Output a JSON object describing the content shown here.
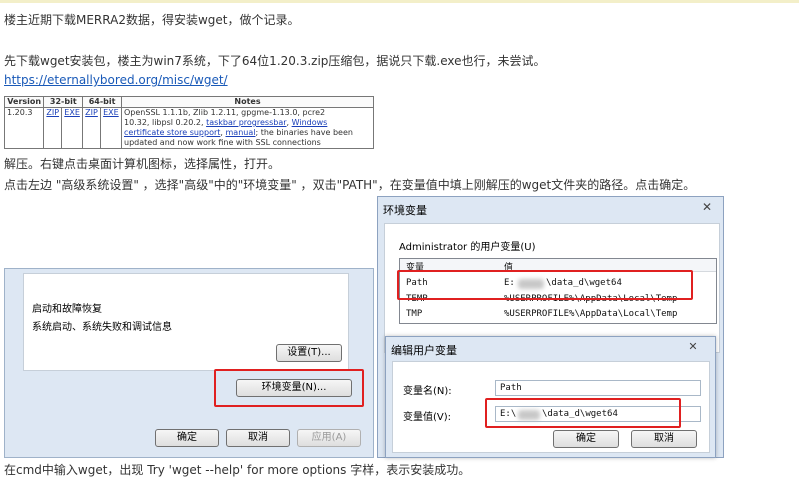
{
  "post": {
    "line1": "楼主近期下载MERRA2数据，得安装wget，做个记录。",
    "line2": "先下载wget安装包，楼主为win7系统，下了64位1.20.3.zip压缩包，据说只下载.exe也行，未尝试。",
    "link": "https://eternallybored.org/misc/wget/",
    "line3": "解压。右键点击桌面计算机图标，选择属性，打开。",
    "line4": "点击左边 \"高级系统设置\"  ，选择\"高级\"中的\"环境变量\"  ，双击\"PATH\"，在变量值中填上刚解压的wget文件夹的路径。点击确定。",
    "line5": "在cmd中输入wget，出现 Try 'wget --help' for more options 字样，表示安装成功。"
  },
  "wget_table": {
    "headers": [
      "Version",
      "32-bit",
      "64-bit",
      "Notes"
    ],
    "row": {
      "version": "1.20.3",
      "zip32": "ZIP",
      "exe32": "EXE",
      "zip64": "ZIP",
      "exe64": "EXE",
      "notes_a": "OpenSSL 1.1.1b, Zlib 1.2.11, gpgme-1.13.0, pcre2",
      "notes_b": "10.32, libpsl 0.20.2, ",
      "notes_link1": "taskbar progressbar",
      "notes_c": ", ",
      "notes_link2": "Windows",
      "notes_link2b": "certificate store support",
      "notes_d": ", ",
      "notes_link3": "manual",
      "notes_e": "; the binaries have been",
      "notes_f": "updated and now work fine with SSL connections"
    }
  },
  "system_props": {
    "section_title": "启动和故障恢复",
    "section_desc": "系统启动、系统失败和调试信息",
    "settings_button": "设置(T)...",
    "env_button": "环境变量(N)...",
    "ok_button": "确定",
    "cancel_button": "取消",
    "apply_button": "应用(A)"
  },
  "env_dialog": {
    "title": "环境变量",
    "user_vars_label": "Administrator 的用户变量(U)",
    "col_var": "变量",
    "col_val": "值",
    "rows": [
      {
        "name": "Path",
        "value_prefix": "E:",
        "value_suffix": "\\data_d\\wget64"
      },
      {
        "name": "TEMP",
        "value": "%USERPROFILE%\\AppData\\Local\\Temp"
      },
      {
        "name": "TMP",
        "value": "%USERPROFILE%\\AppData\\Local\\Temp"
      }
    ]
  },
  "edit_dialog": {
    "title": "编辑用户变量",
    "name_label": "变量名(N):",
    "name_value": "Path",
    "value_label": "变量值(V):",
    "value_prefix": "E:\\",
    "value_suffix": "\\data_d\\wget64",
    "ok_button": "确定",
    "cancel_button": "取消"
  },
  "colors": {
    "highlight": "#e02020",
    "link": "#1a5ab8",
    "dialog_frame": "#dde7f3"
  }
}
